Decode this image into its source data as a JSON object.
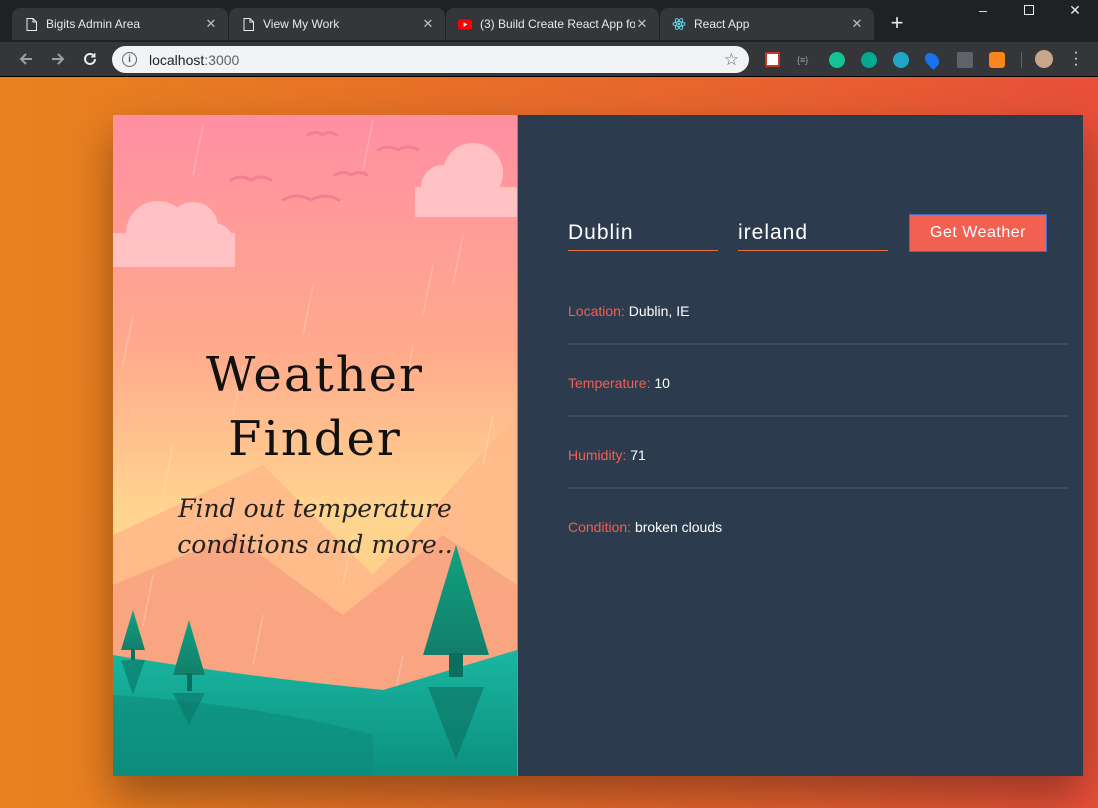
{
  "browser": {
    "tabs": [
      {
        "title": "Bigits Admin Area",
        "icon": "page-icon"
      },
      {
        "title": "View My Work",
        "icon": "page-icon"
      },
      {
        "title": "(3) Build Create React App fo",
        "icon": "youtube-icon"
      },
      {
        "title": "React App",
        "icon": "react-icon",
        "active": true
      }
    ],
    "url_host": "localhost",
    "url_port": ":3000"
  },
  "hero": {
    "title_line1": "Weather",
    "title_line2": "Finder",
    "subtitle_line1": "Find out temperature",
    "subtitle_line2": "conditions and more.."
  },
  "form": {
    "city_value": "Dublin",
    "country_value": "ireland",
    "button_label": "Get Weather"
  },
  "weather": [
    {
      "key": "Location:",
      "value": "Dublin, IE"
    },
    {
      "key": "Temperature:",
      "value": "10"
    },
    {
      "key": "Humidity:",
      "value": "71"
    },
    {
      "key": "Condition:",
      "value": "broken clouds"
    }
  ],
  "colors": {
    "page_bg_start": "#e8821f",
    "page_bg_end": "#e84f3a",
    "panel_bg": "#2c3b4e",
    "accent": "#f16051"
  }
}
